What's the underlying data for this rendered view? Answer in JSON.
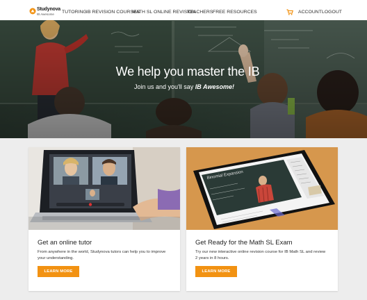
{
  "header": {
    "logo_name": "Studynova",
    "logo_tagline": "IB Awesome",
    "nav": {
      "tutoring": "TUTORING",
      "ib_revision": "IB REVISION COURSES",
      "math_sl": "MATH SL ONLINE REVISION",
      "teachers": "TEACHERS",
      "free_resources": "FREE RESOURCES",
      "account": "ACCOUNT",
      "logout": "LOGOUT"
    },
    "cart_icon": "shopping-cart-icon"
  },
  "hero": {
    "title": "We help you master the IB",
    "subtitle_prefix": "Join us and you'll say ",
    "subtitle_emphasis": "IB Awesome!"
  },
  "cards": [
    {
      "title": "Get an online tutor",
      "text": "From anywhere in the world, Studynova tutors can help you to improve your understanding.",
      "button": "LEARN MORE"
    },
    {
      "title": "Get Ready for the Math SL Exam",
      "text": "Try our new interactive online revision course for IB Math SL and review 2 years in 8 hours.",
      "button": "LEARN MORE",
      "screen_heading": "Binomial Expansion"
    }
  ],
  "colors": {
    "accent": "#f29212",
    "page_bg": "#ededed",
    "header_bg": "#ffffff"
  }
}
